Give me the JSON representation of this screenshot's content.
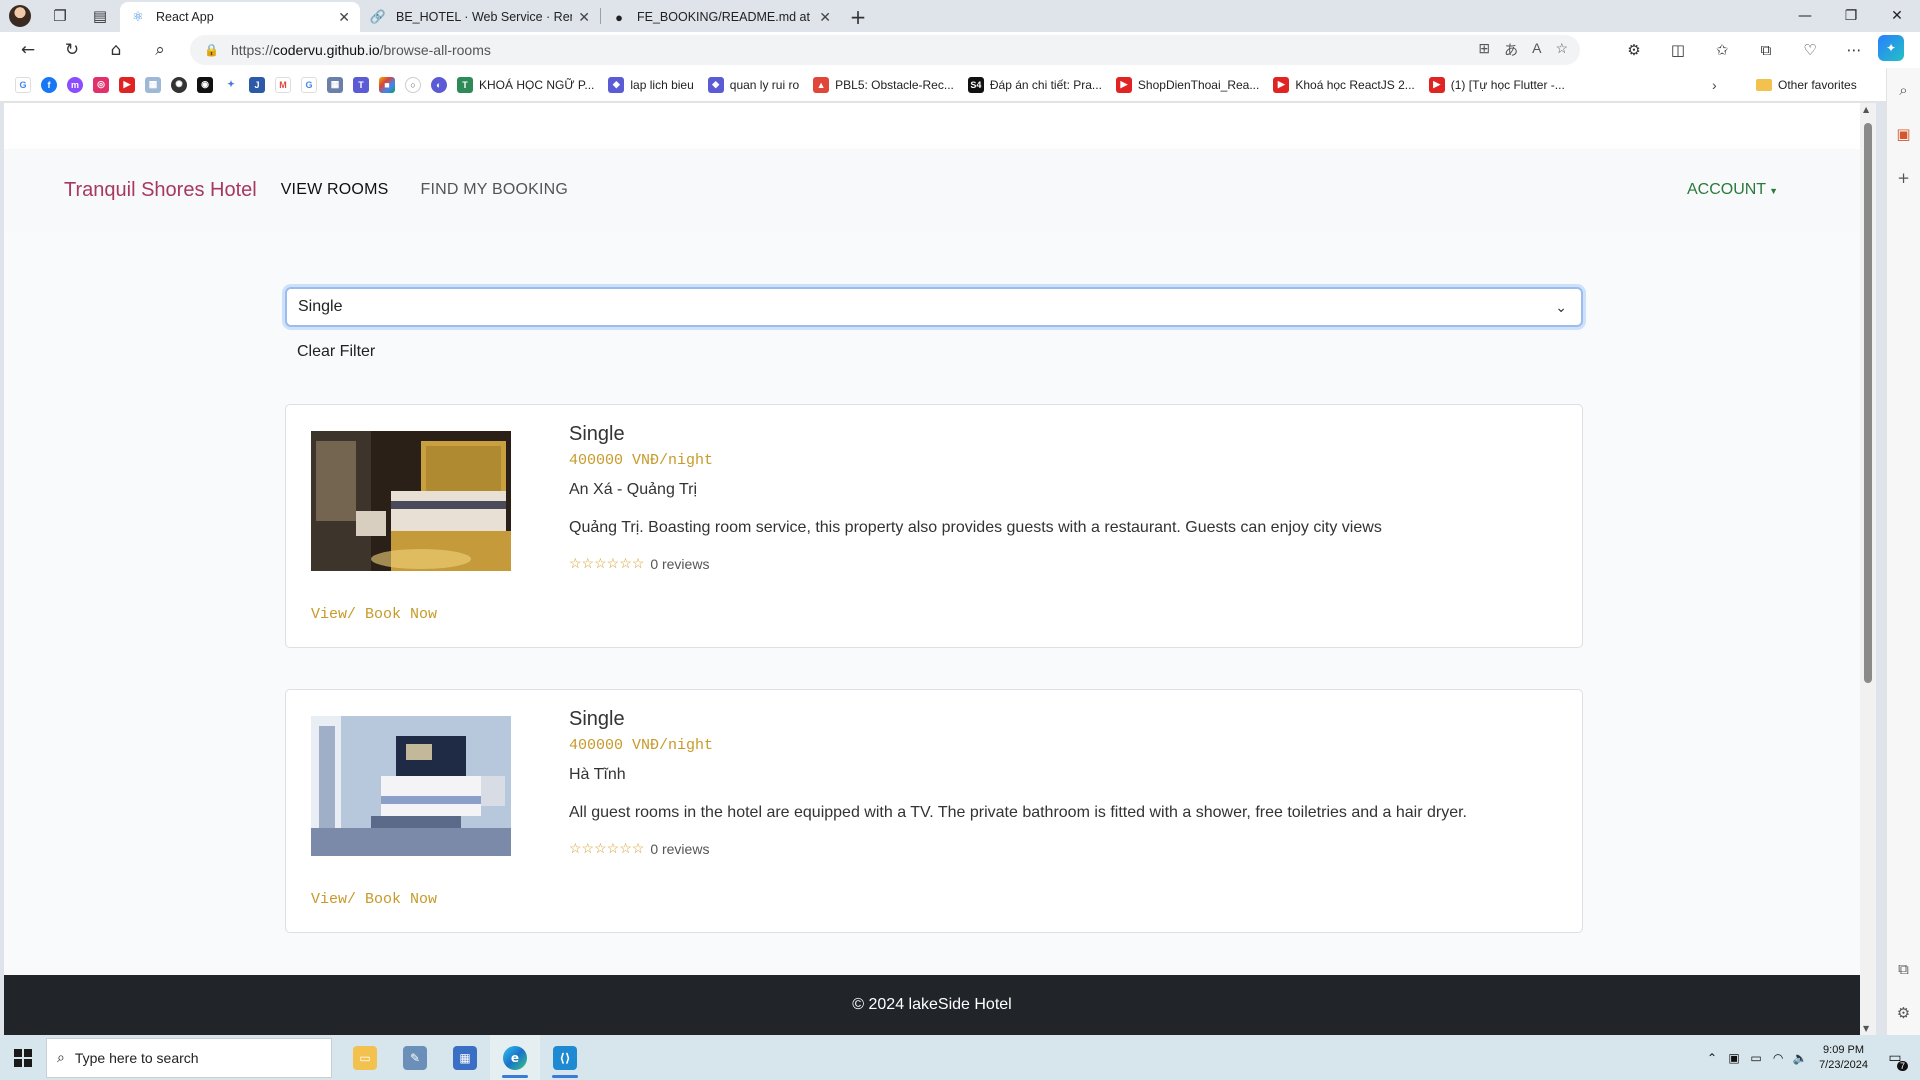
{
  "browser": {
    "tabs": [
      {
        "label": "React App",
        "icon": "react-icon",
        "active": true
      },
      {
        "label": "BE_HOTEL · Web Service · Render",
        "icon": "render-icon",
        "active": false
      },
      {
        "label": "FE_BOOKING/README.md at dev",
        "icon": "github-icon",
        "active": false
      }
    ],
    "url_prefix": "https://",
    "url_host": "codervu.github.io",
    "url_path": "/browse-all-rooms",
    "bookmarks": [
      {
        "label": "KHOÁ HỌC NGỮ P...",
        "icon_color": "#2e8b57"
      },
      {
        "label": "lap lich bieu",
        "icon_color": "#5b5bd6"
      },
      {
        "label": "quan ly rui ro",
        "icon_color": "#5b5bd6"
      },
      {
        "label": "PBL5: Obstacle-Rec...",
        "icon_color": "#e0473a"
      },
      {
        "label": "Đáp án chi tiết: Pra...",
        "icon_color": "#111111"
      },
      {
        "label": "ShopDienThoai_Rea...",
        "icon_color": "#e02424"
      },
      {
        "label": "Khoá học ReactJS 2...",
        "icon_color": "#e02424"
      },
      {
        "label": "(1) [Tự học Flutter -...",
        "icon_color": "#e02424"
      }
    ],
    "other_favorites": "Other favorites"
  },
  "site": {
    "brand": "Tranquil Shores Hotel",
    "nav": {
      "view_rooms": "VIEW ROOMS",
      "find_booking": "FIND MY BOOKING",
      "account": "ACCOUNT"
    },
    "filter": {
      "selected": "Single",
      "clear_label": "Clear Filter"
    },
    "rooms": [
      {
        "type": "Single",
        "price": "400000 VNĐ/night",
        "location": "An Xá - Quảng Trị",
        "description": "Quảng Trị. Boasting room service, this property also provides guests with a restaurant. Guests can enjoy city views",
        "stars": "☆☆☆☆☆☆",
        "reviews": "0 reviews",
        "book_label": "View/ Book Now"
      },
      {
        "type": "Single",
        "price": "400000 VNĐ/night",
        "location": "Hà Tĩnh",
        "description": "All guest rooms in the hotel are equipped with a TV. The private bathroom is fitted with a shower, free toiletries and a hair dryer.",
        "stars": "☆☆☆☆☆☆",
        "reviews": "0 reviews",
        "book_label": "View/ Book Now"
      }
    ],
    "footer": "© 2024 lakeSide Hotel"
  },
  "taskbar": {
    "search_placeholder": "Type here to search",
    "time": "9:09 PM",
    "date": "7/23/2024",
    "notifications": "7"
  },
  "colors": {
    "brand": "#a8385e",
    "account": "#2b7a3d",
    "price_accent": "#c79a2a",
    "footer_bg": "#212529"
  }
}
